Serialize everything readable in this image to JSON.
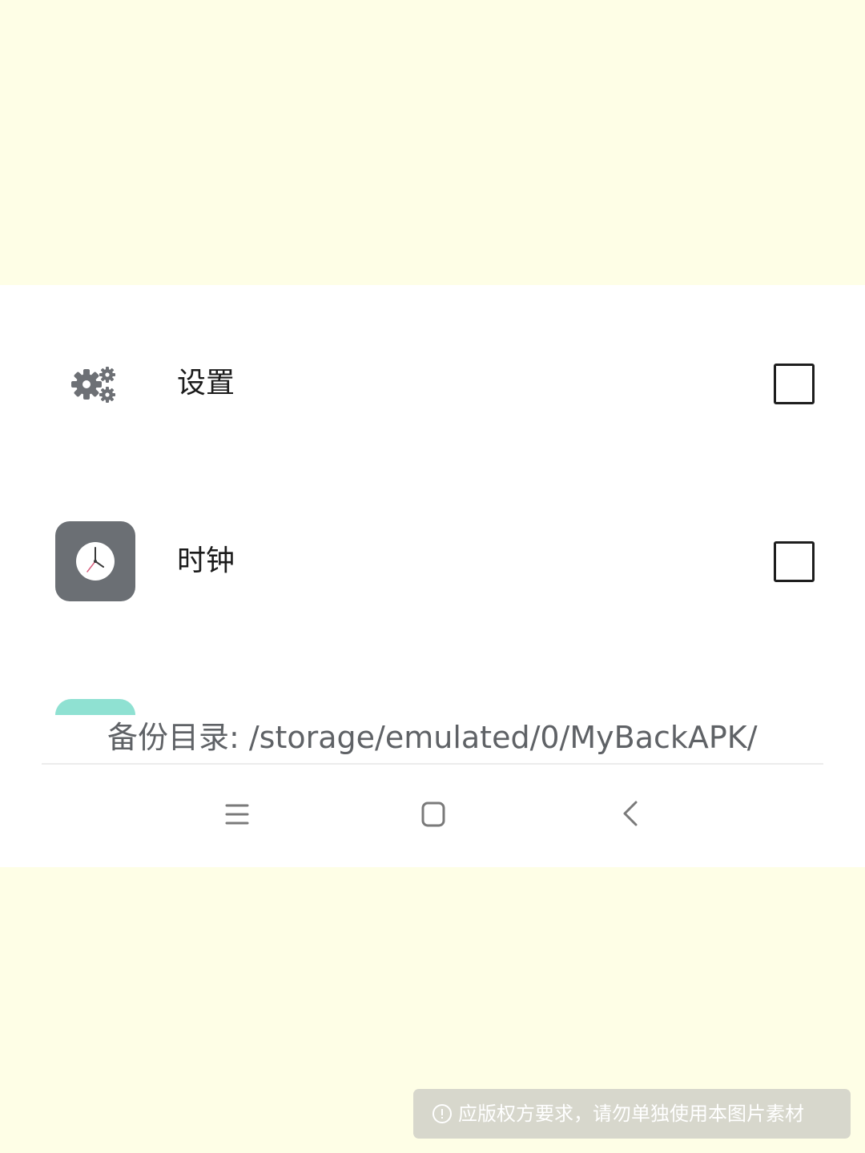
{
  "apps": [
    {
      "label": "设置",
      "icon": "settings-gears-icon",
      "checked": false
    },
    {
      "label": "时钟",
      "icon": "clock-icon",
      "checked": false
    }
  ],
  "backup": {
    "directory_text": "备份目录: /storage/emulated/0/MyBackAPK/"
  },
  "nav_bar": {
    "menu_icon": "menu-icon",
    "home_icon": "home-icon",
    "back_icon": "back-icon"
  },
  "watermark": {
    "text": "应版权方要求，请勿单独使用本图片素材",
    "icon": "info-icon"
  },
  "colors": {
    "page_background": "#fefee6",
    "screen_background": "#ffffff",
    "clock_icon_background": "#6b6f74",
    "partial_app_icon": "#8fe1d2"
  }
}
